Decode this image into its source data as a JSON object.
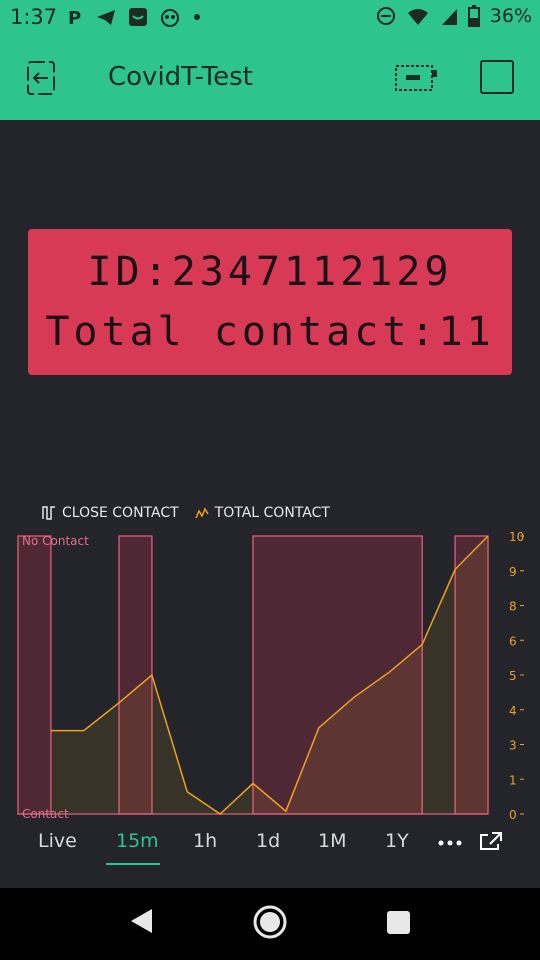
{
  "status": {
    "time": "1:37",
    "battery": "36%"
  },
  "app": {
    "title": "CovidT-Test"
  },
  "lcd": {
    "line1": "ID:2347112129",
    "line2": "Total contact:11"
  },
  "legend": {
    "close": "CLOSE CONTACT",
    "total": "TOTAL CONTACT"
  },
  "tabs": [
    "Live",
    "15m",
    "1h",
    "1d",
    "1M",
    "1Y"
  ],
  "colors": {
    "accent": "#2dc48f",
    "lcd": "#d83a55",
    "close_line": "#e35a7a",
    "total_line": "#f0a020"
  },
  "chart_data": {
    "type": "line",
    "title": "",
    "left_labels": {
      "top": "No Contact",
      "bottom": "Contact"
    },
    "right_ticks": [
      "10",
      "9",
      "8",
      "6",
      "5",
      "4",
      "3",
      "1",
      "0"
    ],
    "ylim": [
      0,
      10
    ],
    "series": [
      {
        "name": "CLOSE CONTACT",
        "type": "step",
        "intervals": [
          [
            0.0,
            0.07
          ],
          [
            0.215,
            0.285
          ],
          [
            0.5,
            0.86
          ],
          [
            0.93,
            1.0
          ]
        ]
      },
      {
        "name": "TOTAL CONTACT",
        "x": [
          0.07,
          0.14,
          0.215,
          0.285,
          0.36,
          0.43,
          0.5,
          0.57,
          0.64,
          0.715,
          0.79,
          0.86,
          0.93,
          1.0
        ],
        "y": [
          3.0,
          3.0,
          4.0,
          5.0,
          0.8,
          0.0,
          1.1,
          0.1,
          3.1,
          4.2,
          5.1,
          6.1,
          8.8,
          10.0
        ]
      }
    ]
  }
}
